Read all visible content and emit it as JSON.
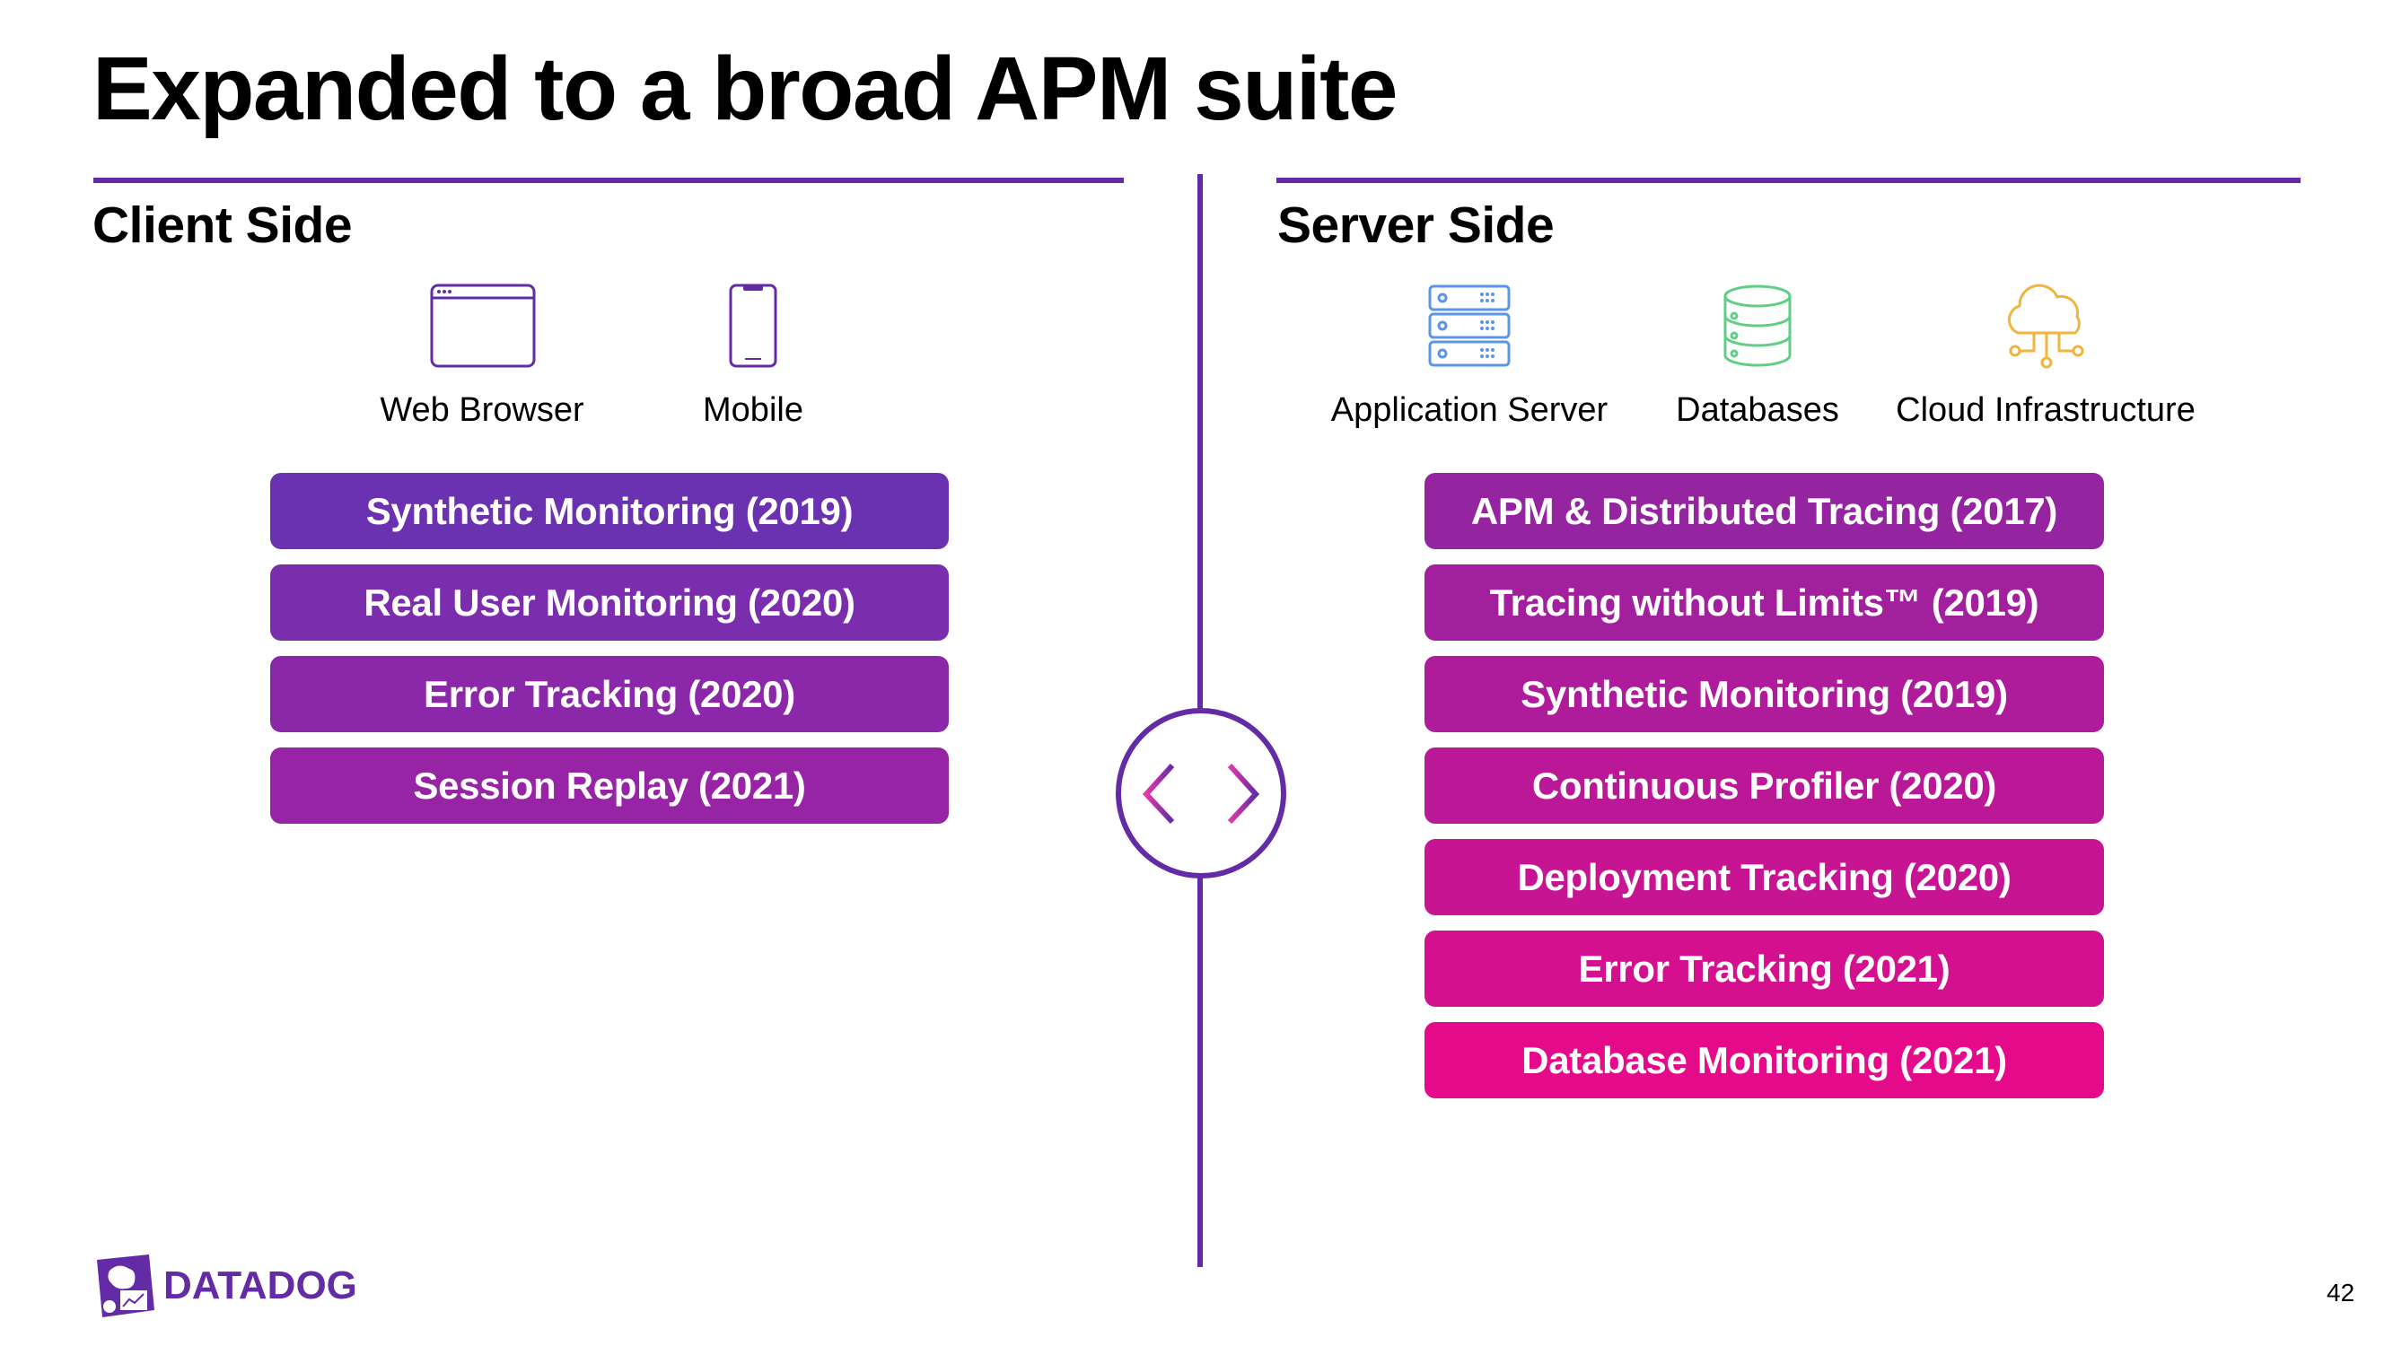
{
  "title": "Expanded to a broad APM suite",
  "theme": {
    "accent": "#632ca6"
  },
  "client": {
    "heading": "Client Side",
    "sources": [
      {
        "label": "Web Browser",
        "icon": "browser-window-icon",
        "color": "#632ca6"
      },
      {
        "label": "Mobile",
        "icon": "mobile-phone-icon",
        "color": "#632ca6"
      }
    ],
    "products": [
      {
        "label": "Synthetic Monitoring (2019)",
        "color": "#6a31b0"
      },
      {
        "label": "Real User Monitoring (2020)",
        "color": "#7a2dad"
      },
      {
        "label": "Error Tracking (2020)",
        "color": "#8a28a9"
      },
      {
        "label": "Session Replay (2021)",
        "color": "#9624a4"
      }
    ]
  },
  "server": {
    "heading": "Server Side",
    "sources": [
      {
        "label": "Application Server",
        "icon": "server-rack-icon",
        "color": "#5b95e8"
      },
      {
        "label": "Databases",
        "icon": "database-icon",
        "color": "#5fcf85"
      },
      {
        "label": "Cloud Infrastructure",
        "icon": "cloud-network-icon",
        "color": "#f0b43f"
      }
    ],
    "products": [
      {
        "label": "APM & Distributed Tracing (2017)",
        "color": "#9524a1"
      },
      {
        "label": "Tracing without Limits™ (2019)",
        "color": "#a2209e"
      },
      {
        "label": "Synthetic Monitoring (2019)",
        "color": "#ae1c9b"
      },
      {
        "label": "Continuous Profiler (2020)",
        "color": "#ba1897"
      },
      {
        "label": "Deployment Tracking (2020)",
        "color": "#c61493"
      },
      {
        "label": "Error Tracking (2021)",
        "color": "#d4108f"
      },
      {
        "label": "Database Monitoring (2021)",
        "color": "#e50a8a"
      }
    ]
  },
  "connector": {
    "icon": "bidirectional-arrow-icon",
    "gradient": [
      "#e23aa8",
      "#632ca6"
    ]
  },
  "footer": {
    "logo_text": "DATADOG",
    "page_number": "42"
  }
}
